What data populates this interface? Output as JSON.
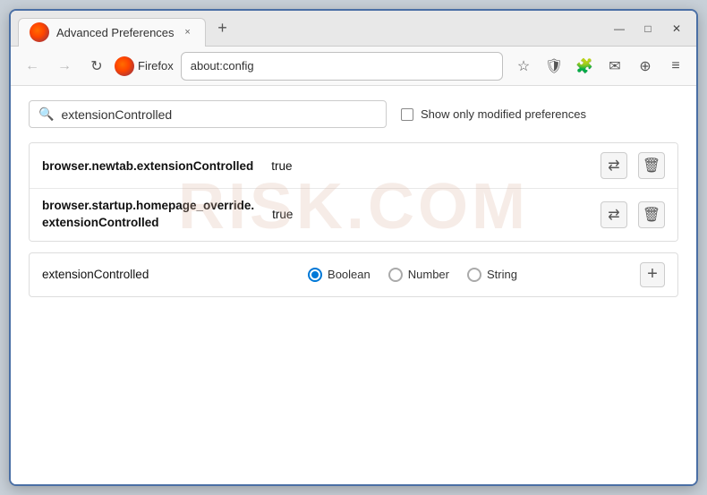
{
  "window": {
    "title": "Advanced Preferences",
    "tab_close": "×",
    "new_tab": "+",
    "min": "—",
    "max": "□",
    "close": "✕"
  },
  "nav": {
    "back": "←",
    "forward": "→",
    "refresh": "↻",
    "firefox_label": "Firefox",
    "url": "about:config",
    "bookmark_icon": "☆",
    "shield_icon": "🛡",
    "ext_icon": "🧩",
    "mail_icon": "✉",
    "profile_icon": "⊕",
    "menu_icon": "≡"
  },
  "search": {
    "placeholder": "extensionControlled",
    "value": "extensionControlled",
    "show_modified_label": "Show only modified preferences"
  },
  "results": [
    {
      "name": "browser.newtab.extensionControlled",
      "value": "true",
      "multiline": false
    },
    {
      "name_line1": "browser.startup.homepage_override.",
      "name_line2": "extensionControlled",
      "value": "true",
      "multiline": true
    }
  ],
  "add_pref": {
    "name": "extensionControlled",
    "types": [
      {
        "label": "Boolean",
        "selected": true
      },
      {
        "label": "Number",
        "selected": false
      },
      {
        "label": "String",
        "selected": false
      }
    ],
    "add_btn_label": "+"
  },
  "watermark": "RISK.COM",
  "icons": {
    "toggle": "⇄",
    "delete": "🗑",
    "search": "🔍"
  }
}
